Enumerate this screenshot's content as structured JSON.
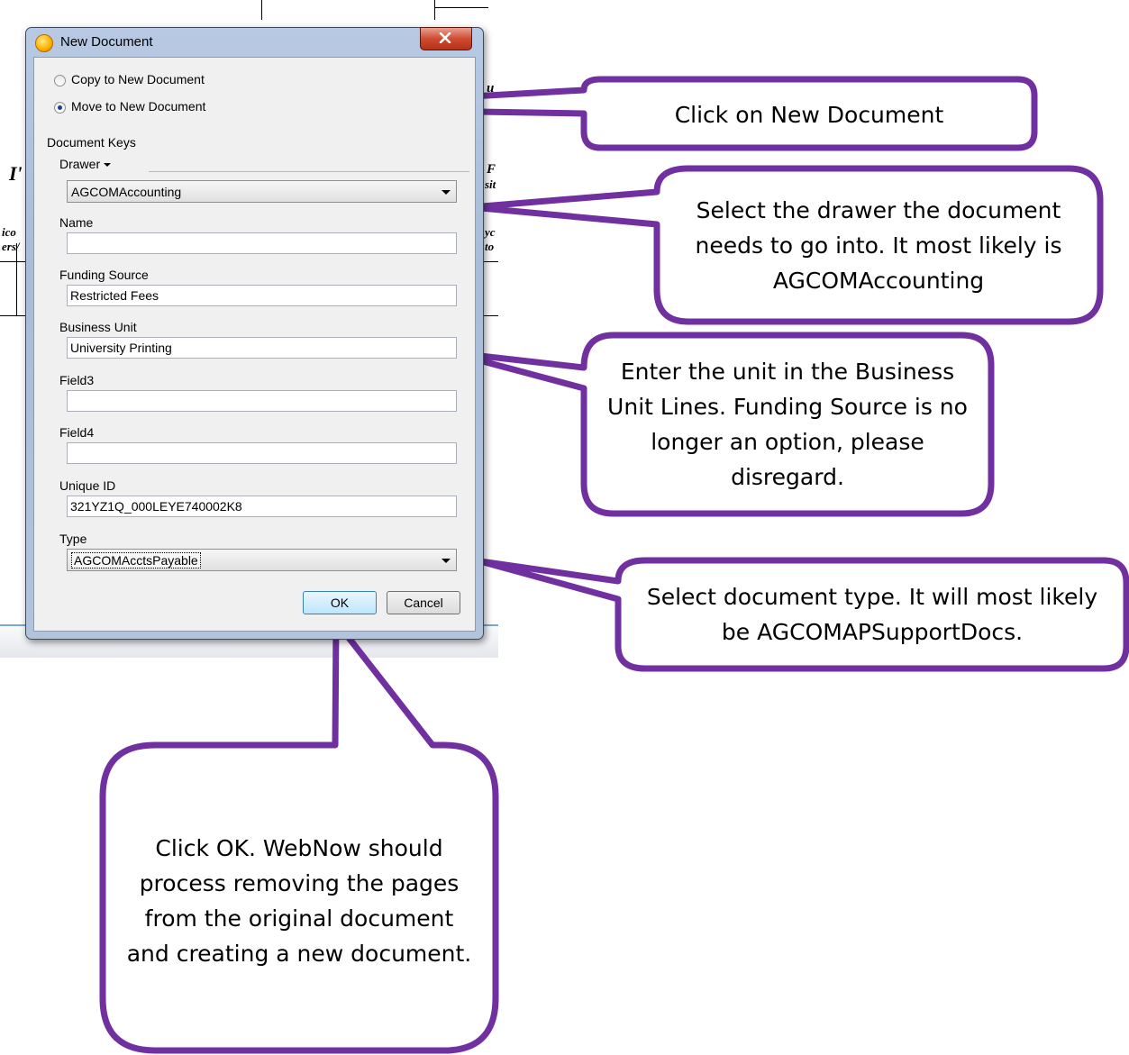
{
  "dialog": {
    "title": "New Document",
    "options": [
      "Copy to New Document",
      "Move to New Document"
    ],
    "selected_option": "Move to New Document",
    "group_label": "Document Keys",
    "drawer_label": "Drawer",
    "drawer_value": "AGCOMAccounting",
    "fields": [
      {
        "label": "Name",
        "value": ""
      },
      {
        "label": "Funding Source",
        "value": "Restricted Fees"
      },
      {
        "label": "Business Unit",
        "value": "University Printing"
      },
      {
        "label": "Field3",
        "value": ""
      },
      {
        "label": "Field4",
        "value": ""
      },
      {
        "label": "Unique ID",
        "value": "321YZ1Q_000LEYE740002K8"
      }
    ],
    "type_label": "Type",
    "type_value": "AGCOMAcctsPayable",
    "ok_label": "OK",
    "cancel_label": "Cancel"
  },
  "callouts": [
    {
      "text": "Click on New Document"
    },
    {
      "text": "Select the drawer the document needs to go into. It most likely is AGCOMAccounting"
    },
    {
      "text": "Enter the unit in the Business Unit Lines. Funding Source is no longer an option, please disregard."
    },
    {
      "text": "Select document type. It will most likely be AGCOMAPSupportDocs."
    },
    {
      "text": "Click OK. WebNow should process removing the pages from the original document and creating a new document."
    }
  ],
  "colors": {
    "callout_border": "#7030a0",
    "callout_fill": "#ffffff",
    "dialog_frame": "#b7c9e3",
    "ok_button": "#bee6fd"
  },
  "icons": [
    "app-icon",
    "close-icon",
    "drawer-dropdown-icon",
    "combo-arrow-icon"
  ]
}
